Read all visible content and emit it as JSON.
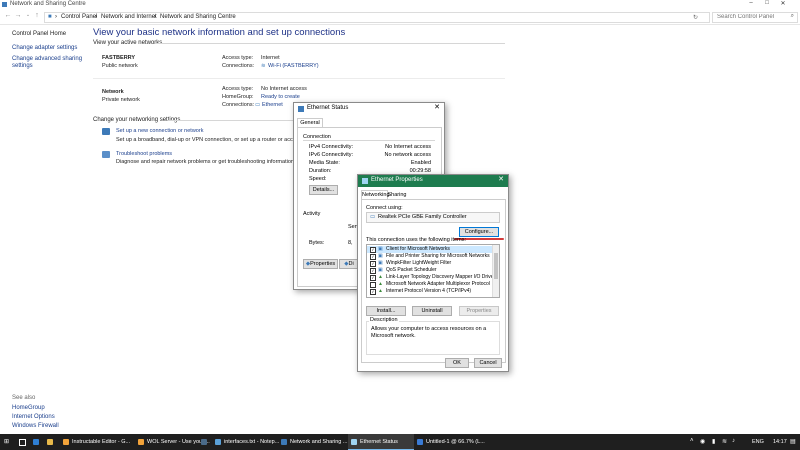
{
  "window": {
    "title": "Network and Sharing Centre"
  },
  "address": {
    "crumbs": [
      "Control Panel",
      "Network and Internet",
      "Network and Sharing Centre"
    ],
    "search_placeholder": "Search Control Panel"
  },
  "sidebar": {
    "links": [
      "Control Panel Home",
      "Change adapter settings",
      "Change advanced sharing settings"
    ],
    "see_also_title": "See also",
    "see_also": [
      "HomeGroup",
      "Internet Options",
      "Windows Firewall"
    ]
  },
  "main": {
    "title": "View your basic network information and set up connections",
    "active_networks": "View your active networks",
    "net1": {
      "name": "FASTBERRY",
      "type": "Public network",
      "access_label": "Access type:",
      "access_value": "Internet",
      "conn_label": "Connections:",
      "conn_value": "Wi-Fi (FASTBERRY)"
    },
    "net2": {
      "name": "Network",
      "type": "Private network",
      "access_label": "Access type:",
      "access_value": "No Internet access",
      "home_label": "HomeGroup:",
      "home_value": "Ready to create",
      "conn_label": "Connections:",
      "conn_value": "Ethernet"
    },
    "change_settings": "Change your networking settings",
    "task1_link": "Set up a new connection or network",
    "task1_desc": "Set up a broadband, dial-up or VPN connection, or set up a router or access point.",
    "task2_link": "Troubleshoot problems",
    "task2_desc": "Diagnose and repair network problems or get troubleshooting information."
  },
  "status_dialog": {
    "title": "Ethernet Status",
    "tab": "General",
    "connection_label": "Connection",
    "rows": [
      {
        "k": "IPv4 Connectivity:",
        "v": "No Internet access"
      },
      {
        "k": "IPv6 Connectivity:",
        "v": "No network access"
      },
      {
        "k": "Media State:",
        "v": "Enabled"
      },
      {
        "k": "Duration:",
        "v": "00:29:58"
      },
      {
        "k": "Speed:",
        "v": ""
      }
    ],
    "details_btn": "Details...",
    "activity_label": "Activity",
    "sent_partial": "Sen",
    "bytes_label": "Bytes:",
    "bytes_value": "8,",
    "properties_btn": "Properties",
    "disable_btn_partial": "Di"
  },
  "props_dialog": {
    "title": "Ethernet Properties",
    "tabs": [
      "Networking",
      "Sharing"
    ],
    "connect_using": "Connect using:",
    "adapter": "Realtek PCIe GBE Family Controller",
    "configure_btn": "Configure...",
    "items_label": "This connection uses the following items:",
    "items": [
      {
        "name": "Client for Microsoft Networks",
        "checked": true
      },
      {
        "name": "File and Printer Sharing for Microsoft Networks",
        "checked": true
      },
      {
        "name": "WinpkFilter LightWeight Filter",
        "checked": true
      },
      {
        "name": "QoS Packet Scheduler",
        "checked": true
      },
      {
        "name": "Link-Layer Topology Discovery Mapper I/O Driver",
        "checked": true
      },
      {
        "name": "Microsoft Network Adapter Multiplexor Protocol",
        "checked": false
      },
      {
        "name": "Internet Protocol Version 4 (TCP/IPv4)",
        "checked": true
      }
    ],
    "install_btn": "Install...",
    "uninstall_btn": "Uninstall",
    "properties_btn": "Properties",
    "description_label": "Description",
    "description": "Allows your computer to access resources on a Microsoft network.",
    "ok_btn": "OK",
    "cancel_btn": "Cancel"
  },
  "taskbar": {
    "apps": [
      "Instructable Editor - G...",
      "WOL Server - Use youri...",
      "interfaces.txt - Notep...",
      "Network and Sharing ...",
      "Ethernet Status",
      "Untitled-1 @ 66.7% (L..."
    ],
    "lang": "ENG",
    "time": "14:17"
  },
  "colors": {
    "accent_green": "#1e7c4f",
    "link": "#1a3e8c",
    "title_blue": "#1e3287",
    "taskbar": "#1f1f1f",
    "selection": "#cce8ff",
    "annotation_red": "#d33a3a"
  }
}
